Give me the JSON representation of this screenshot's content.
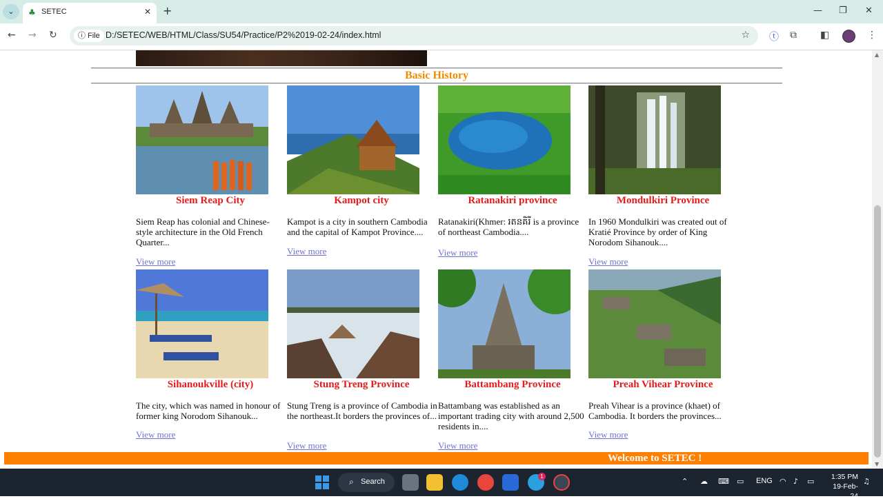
{
  "browser": {
    "tab_title": "SETEC",
    "tab_close": "✕",
    "new_tab": "+",
    "file_chip": "File",
    "url": "D:/SETEC/WEB/HTML/Class/SU54/Practice/P2%2019-02-24/index.html",
    "window_controls": {
      "minimize": "—",
      "restore": "❐",
      "close": "✕"
    },
    "icons": [
      "back-arrow-icon",
      "forward-arrow-icon",
      "reload-icon",
      "info-icon",
      "star-icon",
      "translate-icon",
      "extensions-icon",
      "sidebar-icon",
      "profile-avatar",
      "menu-icon"
    ]
  },
  "page": {
    "section_title": "Basic History",
    "view_more": "View more",
    "footer": "Welcome to SETEC !",
    "cards": [
      {
        "title": "Siem Reap City",
        "desc": "Siem Reap has colonial and Chinese-style architecture in the Old French Quarter..."
      },
      {
        "title": "Kampot city",
        "desc": "Kampot is a city in southern Cambodia and the capital of Kampot Province...."
      },
      {
        "title": "Ratanakiri province",
        "desc": "Ratanakiri(Khmer: រតនគិរី is a province of northeast Cambodia...."
      },
      {
        "title": "Mondulkiri Province",
        "desc": "In 1960 Mondulkiri was created out of Kratié Province by order of King Norodom Sihanouk...."
      },
      {
        "title": "Sihanoukville (city)",
        "desc": "The city, which was named in honour of former king Norodom Sihanouk..."
      },
      {
        "title": "Stung Treng Province",
        "desc": "Stung Treng is a province of Cambodia in the northeast.It borders the provinces of..."
      },
      {
        "title": "Battambang Province",
        "desc": "Battambang was established as an important trading city with around 2,500 residents in...."
      },
      {
        "title": "Preah Vihear Province",
        "desc": "Preah Vihear is a province (khaet) of Cambodia. It borders the provinces..."
      }
    ]
  },
  "taskbar": {
    "search_label": "Search",
    "language": "ENG",
    "time": "1:35 PM",
    "date": "19-Feb-24",
    "telegram_badge": "1"
  },
  "colors": {
    "title_orange": "#f08a00",
    "card_title_red": "#e41b1b",
    "link": "#6f6fd8",
    "footer_bg": "#ff7f00"
  }
}
